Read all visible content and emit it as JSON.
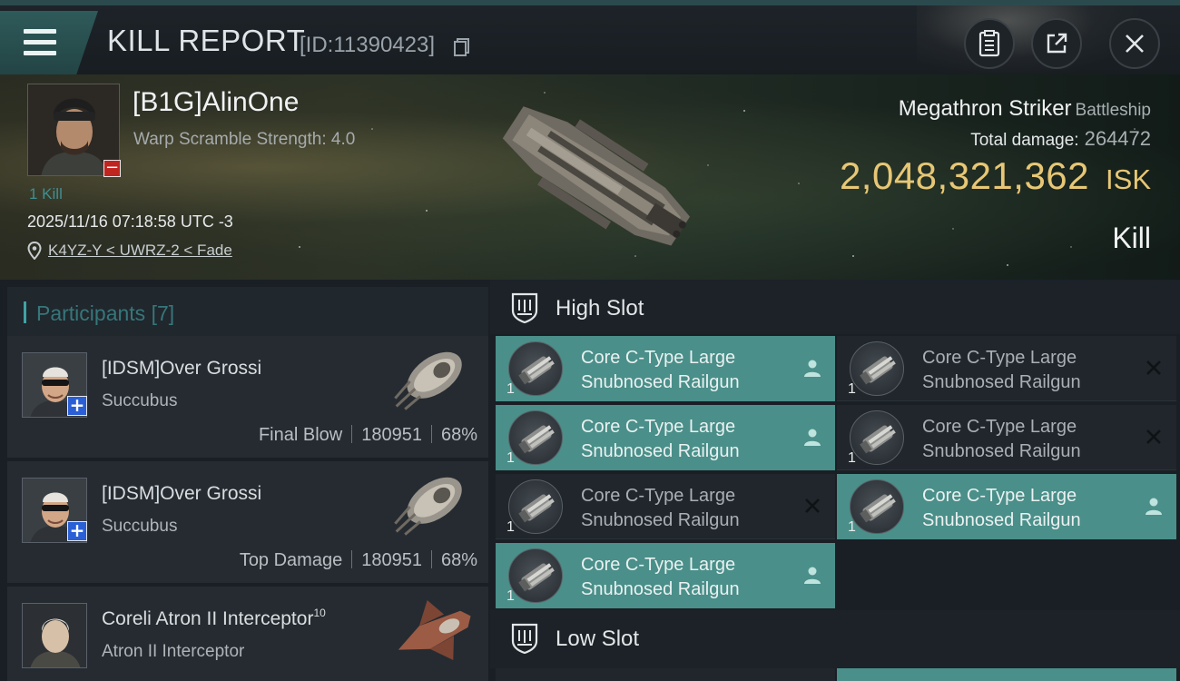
{
  "header": {
    "title": "KILL REPORT",
    "report_id": "[ID:11390423]",
    "icons": [
      "menu-icon",
      "copy-icon",
      "clipboard-icon",
      "share-icon",
      "close-icon"
    ]
  },
  "victim": {
    "name": "[B1G]AlinOne",
    "warp_scramble": "Warp Scramble Strength: 4.0",
    "kill_count": "1 Kill",
    "timestamp": "2025/11/16 07:18:58 UTC -3",
    "location": "K4YZ-Y < UWRZ-2 < Fade",
    "ship_name": "Megathron Striker",
    "ship_class": "Battleship",
    "total_damage_label": "Total damage:",
    "total_damage": "264472",
    "isk_value": "2,048,321,362",
    "isk_unit": "ISK",
    "result": "Kill"
  },
  "participants": {
    "label": "Participants",
    "count": "[7]",
    "rows": [
      {
        "name": "[IDSM]Over Grossi",
        "ship": "Succubus",
        "role": "Final Blow",
        "damage": "180951",
        "percent": "68%"
      },
      {
        "name": "[IDSM]Over Grossi",
        "ship": "Succubus",
        "role": "Top Damage",
        "damage": "180951",
        "percent": "68%"
      },
      {
        "name": "Coreli Atron II Interceptor",
        "name_sup": "10",
        "ship": "Atron II Interceptor"
      }
    ]
  },
  "slots": {
    "high_label": "High Slot",
    "low_label": "Low Slot",
    "high": [
      {
        "qty": "1",
        "line1": "Core C-Type Large",
        "line2": "Snubnosed Railgun",
        "status": "fitted"
      },
      {
        "qty": "1",
        "line1": "Core C-Type Large",
        "line2": "Snubnosed Railgun",
        "status": "destroyed"
      },
      {
        "qty": "1",
        "line1": "Core C-Type Large",
        "line2": "Snubnosed Railgun",
        "status": "fitted"
      },
      {
        "qty": "1",
        "line1": "Core C-Type Large",
        "line2": "Snubnosed Railgun",
        "status": "destroyed"
      },
      {
        "qty": "1",
        "line1": "Core C-Type Large",
        "line2": "Snubnosed Railgun",
        "status": "destroyed"
      },
      {
        "qty": "1",
        "line1": "Core C-Type Large",
        "line2": "Snubnosed Railgun",
        "status": "fitted"
      },
      {
        "qty": "1",
        "line1": "Core C-Type Large",
        "line2": "Snubnosed Railgun",
        "status": "fitted"
      }
    ]
  },
  "colors": {
    "accent_teal": "#4a8f89",
    "isk_gold": "#e7c775",
    "kill_teal": "#3e8f93",
    "badge_red": "#c0251f",
    "badge_blue": "#2a5fd6"
  }
}
